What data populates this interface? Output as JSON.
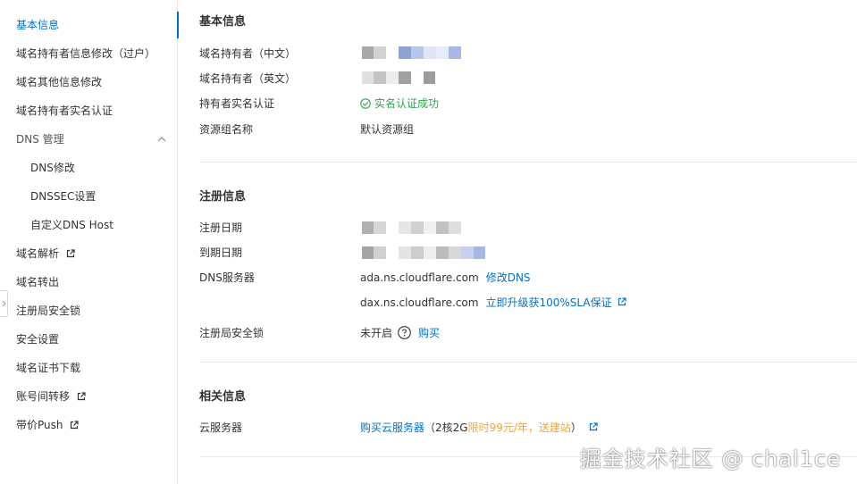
{
  "sidebar": {
    "items": [
      {
        "label": "基本信息"
      },
      {
        "label": "域名持有者信息修改（过户）"
      },
      {
        "label": "域名其他信息修改"
      },
      {
        "label": "域名持有者实名认证"
      },
      {
        "label": "DNS 管理"
      },
      {
        "label": "DNS修改"
      },
      {
        "label": "DNSSEC设置"
      },
      {
        "label": "自定义DNS Host"
      },
      {
        "label": "域名解析"
      },
      {
        "label": "域名转出"
      },
      {
        "label": "注册局安全锁"
      },
      {
        "label": "安全设置"
      },
      {
        "label": "域名证书下载"
      },
      {
        "label": "账号间转移"
      },
      {
        "label": "带价Push"
      }
    ]
  },
  "basic": {
    "title": "基本信息",
    "owner_cn_label": "域名持有者（中文）",
    "owner_en_label": "域名持有者（英文）",
    "realname_label": "持有者实名认证",
    "realname_value": "实名认证成功",
    "resource_group_label": "资源组名称",
    "resource_group_value": "默认资源组"
  },
  "registration": {
    "title": "注册信息",
    "reg_date_label": "注册日期",
    "exp_date_label": "到期日期",
    "dns_label": "DNS服务器",
    "dns1": "ada.ns.cloudflare.com",
    "dns_modify_link": "修改DNS",
    "dns2": "dax.ns.cloudflare.com",
    "sla_link": "立即升级获100%SLA保证",
    "lock_label": "注册局安全锁",
    "lock_value": "未开启",
    "lock_buy": "购买"
  },
  "related": {
    "title": "相关信息",
    "cloud_label": "云服务器",
    "cloud_link": "购买云服务器",
    "cloud_paren_open": "（2核2G",
    "cloud_promo": "限时99元/年，送建站",
    "cloud_paren_close": "）"
  },
  "watermark": "掘金技术社区 @ chal1ce",
  "colors": {
    "accent": "#0070cc",
    "success": "#2ea44f",
    "promo": "#f5a623"
  }
}
